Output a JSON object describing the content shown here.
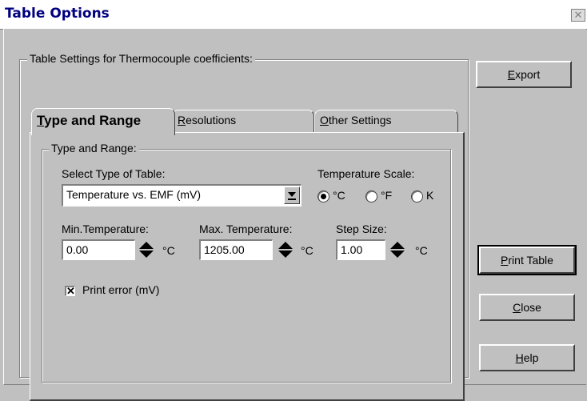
{
  "window": {
    "title": "Table Options",
    "close_symbol": "✕"
  },
  "outer_group": {
    "legend": "Table Settings for Thermocouple coefficients:"
  },
  "tabs": [
    {
      "label": "Type and Range",
      "accel": "T",
      "rest": "ype and Range",
      "active": true
    },
    {
      "label": "Resolutions",
      "accel": "R",
      "rest": "esolutions",
      "active": false
    },
    {
      "label": "Other Settings",
      "accel": "O",
      "rest": "ther Settings",
      "active": false
    }
  ],
  "panel": {
    "group_legend": "Type and Range:",
    "table_type": {
      "label": "Select Type of Table:",
      "value": "Temperature vs. EMF (mV)"
    },
    "scale": {
      "label": "Temperature Scale:",
      "options": [
        {
          "label": "°C",
          "checked": true
        },
        {
          "label": "°F",
          "checked": false
        },
        {
          "label": "K",
          "checked": false
        }
      ]
    },
    "min_temp": {
      "label": "Min.Temperature:",
      "value": "0.00",
      "unit": "°C"
    },
    "max_temp": {
      "label": "Max. Temperature:",
      "value": "1205.00",
      "unit": "°C"
    },
    "step": {
      "label": "Step Size:",
      "value": "1.00",
      "unit": "°C"
    },
    "print_error": {
      "label": "Print error (mV)",
      "checked": true,
      "mark": "✕"
    }
  },
  "buttons": {
    "export": {
      "accel": "E",
      "rest": "xport"
    },
    "print_table": {
      "accel": "P",
      "rest": "rint Table"
    },
    "close": {
      "accel": "C",
      "rest": "lose"
    },
    "help": {
      "accel": "H",
      "rest": "elp"
    }
  },
  "colors": {
    "face": "#c0c0c0",
    "title_text": "#000080"
  }
}
